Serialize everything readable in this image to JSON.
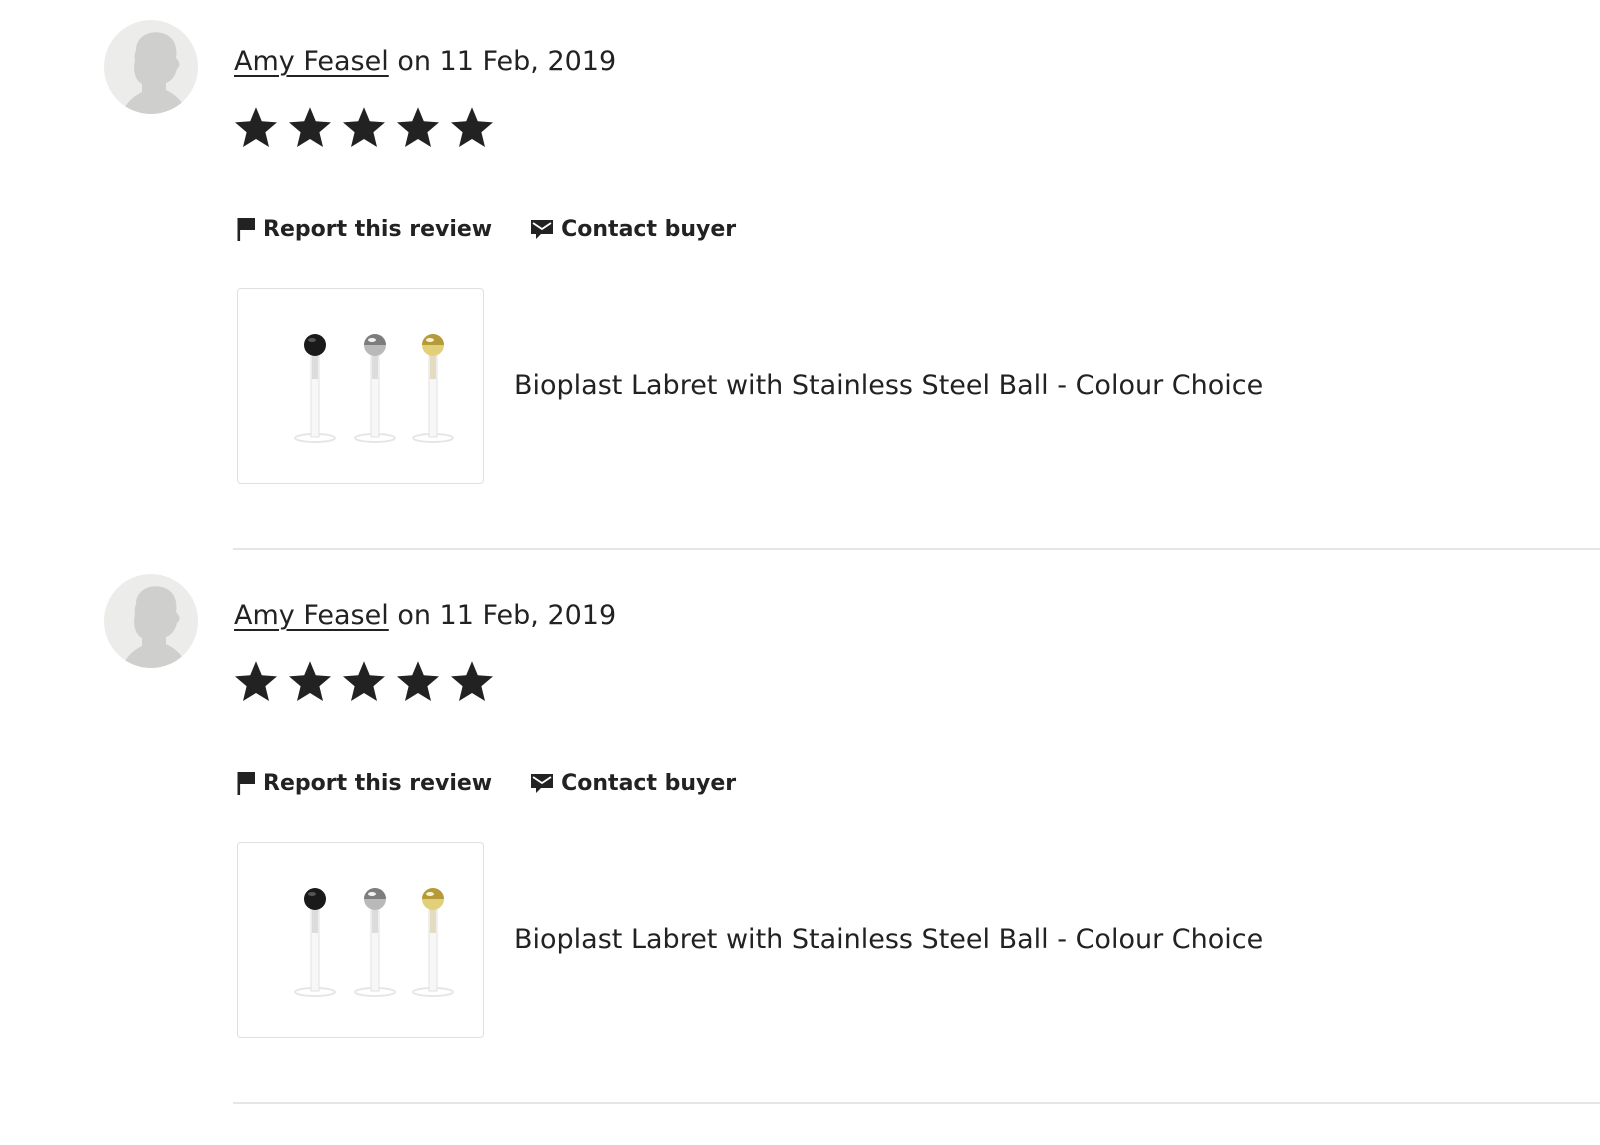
{
  "colors": {
    "text": "#222222",
    "star": "#222222",
    "divider": "#e6e6e6",
    "avatar_bg": "#ecedea",
    "avatar_silhouette": "#cfd0cd"
  },
  "icons": {
    "avatar": "default-user-silhouette-icon",
    "star": "filled-star-icon",
    "report": "flag-icon",
    "contact": "envelope-icon"
  },
  "reviews": [
    {
      "reviewer_name": "Amy Feasel",
      "date_text": "on 11 Feb, 2019",
      "rating": 5,
      "rating_max": 5,
      "report_label": "Report this review",
      "contact_label": "Contact buyer",
      "listing": {
        "title": "Bioplast Labret with Stainless Steel Ball - Colour Choice",
        "ball_colors": [
          "black",
          "silver",
          "gold"
        ]
      }
    },
    {
      "reviewer_name": "Amy Feasel",
      "date_text": "on 11 Feb, 2019",
      "rating": 5,
      "rating_max": 5,
      "report_label": "Report this review",
      "contact_label": "Contact buyer",
      "listing": {
        "title": "Bioplast Labret with Stainless Steel Ball - Colour Choice",
        "ball_colors": [
          "black",
          "silver",
          "gold"
        ]
      }
    }
  ]
}
